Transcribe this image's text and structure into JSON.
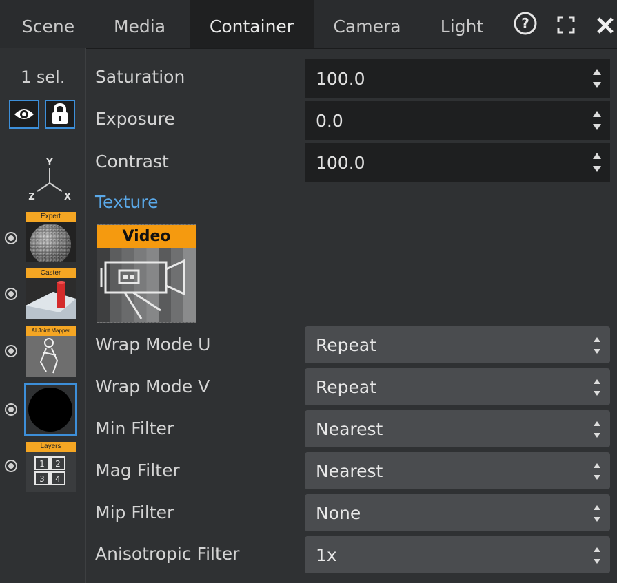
{
  "tabs": [
    {
      "label": "Scene",
      "active": false
    },
    {
      "label": "Media",
      "active": false
    },
    {
      "label": "Container",
      "active": true
    },
    {
      "label": "Camera",
      "active": false
    },
    {
      "label": "Light",
      "active": false
    }
  ],
  "toolbar_icons": [
    "help-icon",
    "expand-icon",
    "close-icon"
  ],
  "left_panel": {
    "selection_label": "1 sel.",
    "toggles": [
      "visibility-eye-icon",
      "lock-icon"
    ],
    "axis": {
      "y": "Y",
      "z": "Z",
      "x": "X"
    },
    "nodes": [
      {
        "label": "Expert",
        "icon": "sphere-thumbnail"
      },
      {
        "label": "Caster",
        "icon": "caster-thumbnail"
      },
      {
        "label": "AI Joint Mapper",
        "icon": "joint-mapper-thumbnail"
      },
      {
        "label": "",
        "icon": "black-circle-thumbnail",
        "selected": true
      },
      {
        "label": "Layers",
        "icon": "layers-thumbnail",
        "cells": [
          "1",
          "2",
          "3",
          "4"
        ]
      }
    ]
  },
  "properties": {
    "saturation": {
      "label": "Saturation",
      "value": "100.0"
    },
    "exposure": {
      "label": "Exposure",
      "value": "0.0"
    },
    "contrast": {
      "label": "Contrast",
      "value": "100.0"
    }
  },
  "texture": {
    "section_title": "Texture",
    "header": "Video",
    "wrap_u": {
      "label": "Wrap Mode U",
      "value": "Repeat"
    },
    "wrap_v": {
      "label": "Wrap Mode V",
      "value": "Repeat"
    },
    "min_filter": {
      "label": "Min Filter",
      "value": "Nearest"
    },
    "mag_filter": {
      "label": "Mag Filter",
      "value": "Nearest"
    },
    "mip_filter": {
      "label": "Mip Filter",
      "value": "None"
    },
    "anisotropic": {
      "label": "Anisotropic Filter",
      "value": "1x"
    }
  },
  "colors": {
    "accent_blue": "#3d8fd9",
    "section_blue": "#5aa8e8",
    "orange": "#f59a0f"
  }
}
